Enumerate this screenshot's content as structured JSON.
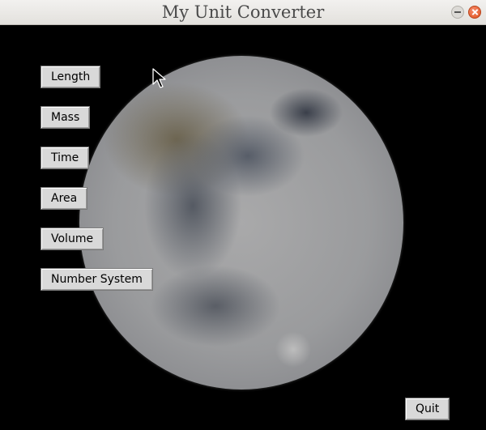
{
  "window": {
    "title": "My Unit Converter"
  },
  "menu": {
    "buttons": [
      {
        "label": "Length"
      },
      {
        "label": "Mass"
      },
      {
        "label": "Time"
      },
      {
        "label": "Area"
      },
      {
        "label": "Volume"
      },
      {
        "label": "Number System"
      }
    ]
  },
  "footer": {
    "quit_label": "Quit"
  },
  "icons": {
    "minimize": "minimize-icon",
    "close": "close-icon",
    "cursor": "mouse-cursor-icon",
    "background": "moon-image"
  },
  "colors": {
    "background": "#000000",
    "button": "#d9d9d9",
    "close": "#e0531f"
  }
}
